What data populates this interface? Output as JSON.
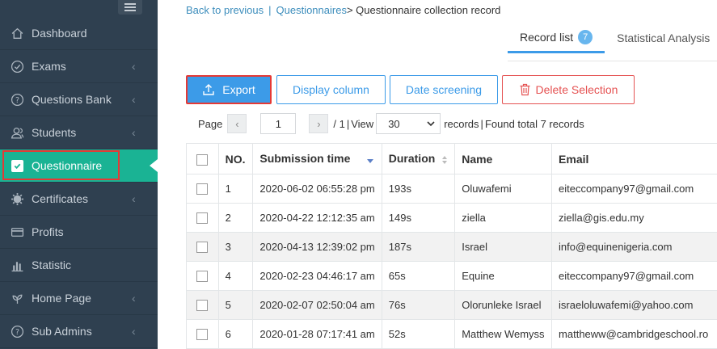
{
  "sidebar": {
    "items": [
      {
        "label": "Dashboard",
        "icon": "home-icon",
        "has_chevron": false
      },
      {
        "label": "Exams",
        "icon": "check-circle-icon",
        "has_chevron": true
      },
      {
        "label": "Questions Bank",
        "icon": "question-circle-icon",
        "has_chevron": true
      },
      {
        "label": "Students",
        "icon": "users-icon",
        "has_chevron": true
      },
      {
        "label": "Questionnaire",
        "icon": "checkbox-icon",
        "has_chevron": false,
        "active": true
      },
      {
        "label": "Certificates",
        "icon": "certificate-icon",
        "has_chevron": true
      },
      {
        "label": "Profits",
        "icon": "credit-card-icon",
        "has_chevron": false
      },
      {
        "label": "Statistic",
        "icon": "bar-chart-icon",
        "has_chevron": false
      },
      {
        "label": "Home Page",
        "icon": "leaf-icon",
        "has_chevron": true
      },
      {
        "label": "Sub Admins",
        "icon": "question-circle-icon",
        "has_chevron": true
      }
    ]
  },
  "breadcrumb": {
    "back": "Back to previous",
    "separator": "|",
    "parent": "Questionnaires",
    "arrow": ">",
    "current": "Questionnaire collection record"
  },
  "tabs": [
    {
      "label": "Record list",
      "badge": "7",
      "active": true
    },
    {
      "label": "Statistical Analysis",
      "active": false
    }
  ],
  "toolbar": {
    "export_label": "Export",
    "display_column_label": "Display column",
    "date_screening_label": "Date screening",
    "delete_selection_label": "Delete Selection"
  },
  "pager": {
    "page_label": "Page",
    "page_value": "1",
    "total_pages": "/ 1",
    "view_label": "View",
    "per_page": "30",
    "records_label": "records",
    "found_label": "Found total 7 records"
  },
  "table": {
    "headers": [
      "NO.",
      "Submission time",
      "Duration",
      "Name",
      "Email"
    ],
    "rows": [
      {
        "no": "1",
        "time": "2020-06-02 06:55:28 pm",
        "duration": "193s",
        "name": "Oluwafemi",
        "email": "eiteccompany97@gmail.com"
      },
      {
        "no": "2",
        "time": "2020-04-22 12:12:35 am",
        "duration": "149s",
        "name": "ziella",
        "email": "ziella@gis.edu.my"
      },
      {
        "no": "3",
        "time": "2020-04-13 12:39:02 pm",
        "duration": "187s",
        "name": "Israel",
        "email": "info@equinenigeria.com"
      },
      {
        "no": "4",
        "time": "2020-02-23 04:46:17 am",
        "duration": "65s",
        "name": "Equine",
        "email": "eiteccompany97@gmail.com"
      },
      {
        "no": "5",
        "time": "2020-02-07 02:50:04 am",
        "duration": "76s",
        "name": "Olorunleke Israel",
        "email": "israeloluwafemi@yahoo.com"
      },
      {
        "no": "6",
        "time": "2020-01-28 07:17:41 am",
        "duration": "52s",
        "name": "Matthew Wemyss",
        "email": "mattheww@cambridgeschool.ro"
      }
    ]
  },
  "colors": {
    "sidebar_bg": "#2f4050",
    "active_green": "#1ab394",
    "primary_blue": "#3c9be8",
    "danger_red": "#e55353",
    "highlight_red": "#e53935"
  }
}
